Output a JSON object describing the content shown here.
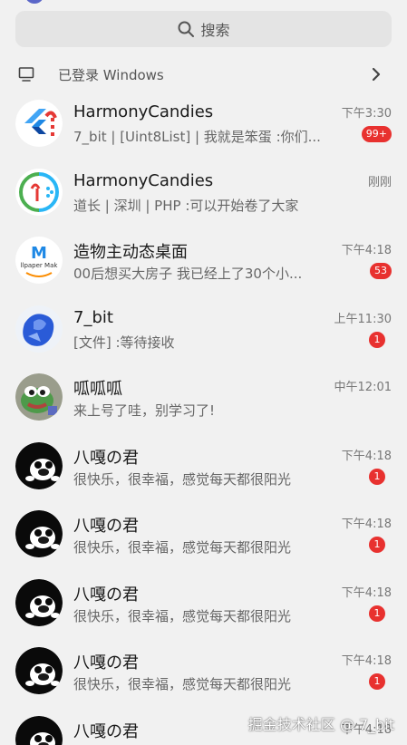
{
  "search": {
    "label": "搜索",
    "icon": "search-icon"
  },
  "device": {
    "label": "已登录 Windows",
    "icon": "computer-icon",
    "chevron": "chevron-right-icon"
  },
  "conversations": [
    {
      "name": "HarmonyCandies",
      "preview": "7_bit | [Uint8List] | 我就是笨蛋 :你们...",
      "time": "下午3:30",
      "badge": "99+",
      "avatar": "flutter-candy-avatar"
    },
    {
      "name": "HarmonyCandies",
      "preview": "道长 | 深圳 | PHP :可以开始卷了大家",
      "time": "刚刚",
      "badge": "",
      "avatar": "harmony-candy-avatar"
    },
    {
      "name": "造物主动态桌面",
      "preview": "00后想买大房子 我已经上了30个小...",
      "time": "下午4:18",
      "badge": "53",
      "avatar": "wallpaper-maker-avatar"
    },
    {
      "name": "7_bit",
      "preview": "[文件] :等待接收",
      "time": "上午11:30",
      "badge": "1",
      "avatar": "blue-paint-avatar"
    },
    {
      "name": "呱呱呱",
      "preview": "来上号了哇，别学习了!",
      "time": "中午12:01",
      "badge": "",
      "avatar": "frog-avatar"
    },
    {
      "name": "八嘎の君",
      "preview": "很快乐，很幸福，感觉每天都很阳光",
      "time": "下午4:18",
      "badge": "1",
      "avatar": "penguin-avatar"
    },
    {
      "name": "八嘎の君",
      "preview": "很快乐，很幸福，感觉每天都很阳光",
      "time": "下午4:18",
      "badge": "1",
      "avatar": "penguin-avatar"
    },
    {
      "name": "八嘎の君",
      "preview": "很快乐，很幸福，感觉每天都很阳光",
      "time": "下午4:18",
      "badge": "1",
      "avatar": "penguin-avatar"
    },
    {
      "name": "八嘎の君",
      "preview": "很快乐，很幸福，感觉每天都很阳光",
      "time": "下午4:18",
      "badge": "1",
      "avatar": "penguin-avatar"
    },
    {
      "name": "八嘎の君",
      "preview": "",
      "time": "下午4:18",
      "badge": "",
      "avatar": "penguin-avatar"
    }
  ],
  "watermark": "掘金技术社区 @ 7_bit",
  "colors": {
    "badge": "#e8312f",
    "background": "#f1f1f1",
    "search_bg": "#e4e4e4"
  }
}
